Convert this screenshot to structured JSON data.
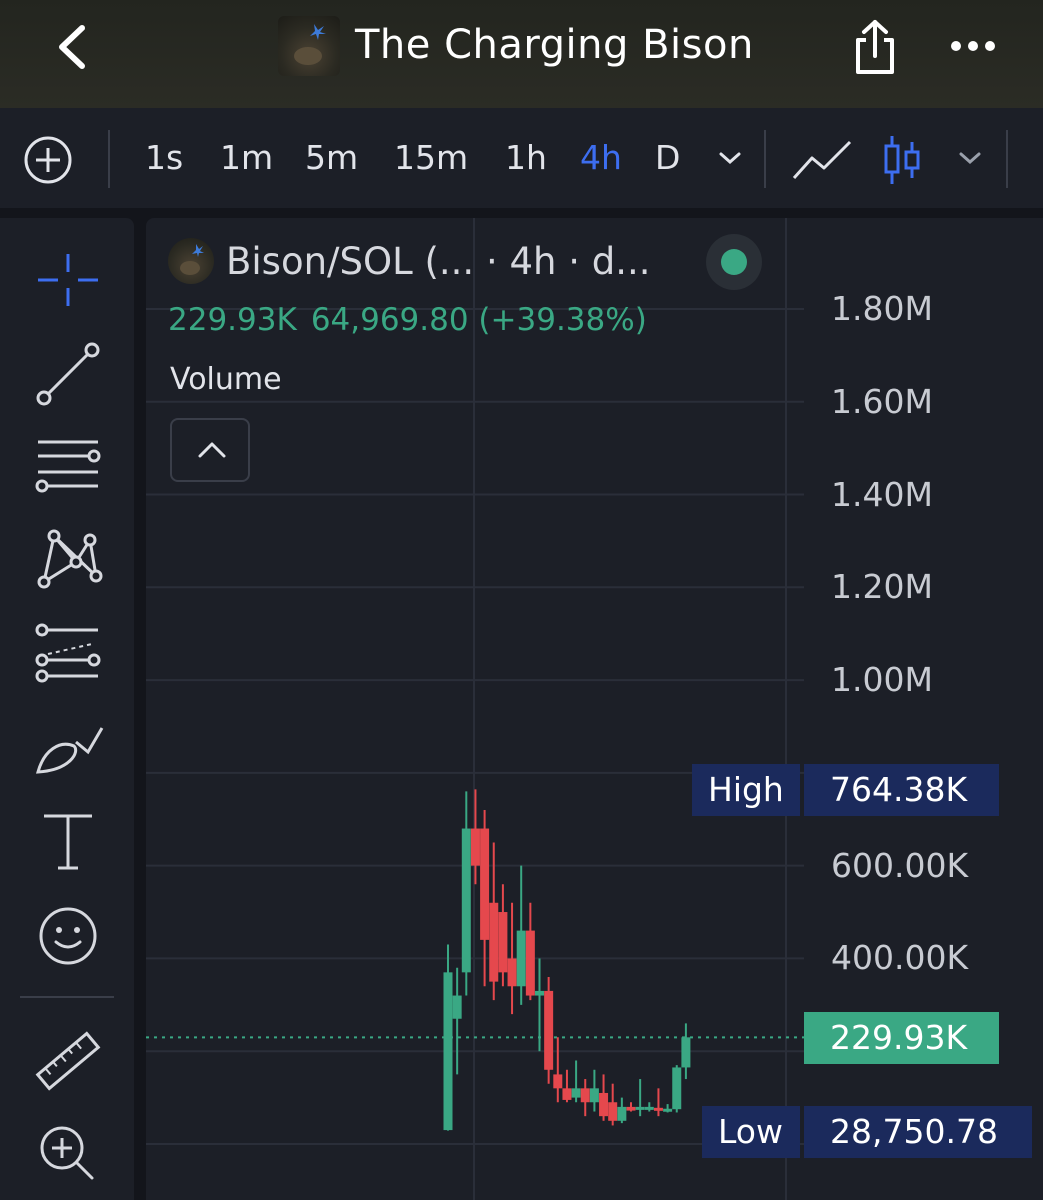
{
  "header": {
    "title": "The Charging Bison"
  },
  "timeframes": [
    "1s",
    "1m",
    "5m",
    "15m",
    "1h",
    "4h",
    "D"
  ],
  "active_timeframe": "4h",
  "legend": {
    "title": "Bison/SOL (... · 4h · d...",
    "last_value": "229.93K",
    "change": "64,969.80 (+39.38%)",
    "volume_label": "Volume"
  },
  "price_tags": {
    "high_label": "High",
    "high_value": "764.38K",
    "current_value": "229.93K",
    "low_label": "Low",
    "low_value": "28,750.78"
  },
  "colors": {
    "up": "#3aa884",
    "down": "#e5484d",
    "accent": "#3d6ef0",
    "tag_bg": "#1b2a5c"
  },
  "chart_data": {
    "type": "candlestick",
    "y_ticks": [
      "1.80M",
      "1.60M",
      "1.40M",
      "1.20M",
      "1.00M",
      "600.00K",
      "400.00K"
    ],
    "y_tick_values": [
      1800000,
      1600000,
      1400000,
      1200000,
      1000000,
      600000,
      400000
    ],
    "ylim": [
      0,
      1900000
    ],
    "current_price": 229930,
    "high": 764380,
    "low": 28750.78,
    "candles": [
      {
        "o": 30000,
        "h": 430000,
        "l": 28750,
        "c": 370000
      },
      {
        "o": 270000,
        "h": 380000,
        "l": 150000,
        "c": 320000
      },
      {
        "o": 370000,
        "h": 760000,
        "l": 320000,
        "c": 680000
      },
      {
        "o": 680000,
        "h": 764380,
        "l": 560000,
        "c": 600000
      },
      {
        "o": 680000,
        "h": 720000,
        "l": 340000,
        "c": 440000
      },
      {
        "o": 520000,
        "h": 650000,
        "l": 310000,
        "c": 350000
      },
      {
        "o": 500000,
        "h": 560000,
        "l": 340000,
        "c": 370000
      },
      {
        "o": 400000,
        "h": 520000,
        "l": 280000,
        "c": 340000
      },
      {
        "o": 340000,
        "h": 600000,
        "l": 300000,
        "c": 460000
      },
      {
        "o": 460000,
        "h": 520000,
        "l": 310000,
        "c": 320000
      },
      {
        "o": 320000,
        "h": 400000,
        "l": 200000,
        "c": 330000
      },
      {
        "o": 330000,
        "h": 360000,
        "l": 130000,
        "c": 160000
      },
      {
        "o": 150000,
        "h": 230000,
        "l": 90000,
        "c": 120000
      },
      {
        "o": 120000,
        "h": 160000,
        "l": 90000,
        "c": 95000
      },
      {
        "o": 100000,
        "h": 180000,
        "l": 90000,
        "c": 120000
      },
      {
        "o": 120000,
        "h": 140000,
        "l": 60000,
        "c": 90000
      },
      {
        "o": 90000,
        "h": 160000,
        "l": 70000,
        "c": 120000
      },
      {
        "o": 110000,
        "h": 150000,
        "l": 50000,
        "c": 60000
      },
      {
        "o": 90000,
        "h": 130000,
        "l": 40000,
        "c": 50000
      },
      {
        "o": 50000,
        "h": 100000,
        "l": 45000,
        "c": 80000
      },
      {
        "o": 80000,
        "h": 90000,
        "l": 70000,
        "c": 72000
      },
      {
        "o": 75000,
        "h": 140000,
        "l": 60000,
        "c": 80000
      },
      {
        "o": 76000,
        "h": 90000,
        "l": 70000,
        "c": 80000
      },
      {
        "o": 78000,
        "h": 120000,
        "l": 60000,
        "c": 72000
      },
      {
        "o": 72000,
        "h": 86000,
        "l": 68000,
        "c": 76000
      },
      {
        "o": 75000,
        "h": 170000,
        "l": 68000,
        "c": 165000
      },
      {
        "o": 165000,
        "h": 260000,
        "l": 140000,
        "c": 229930
      }
    ]
  }
}
